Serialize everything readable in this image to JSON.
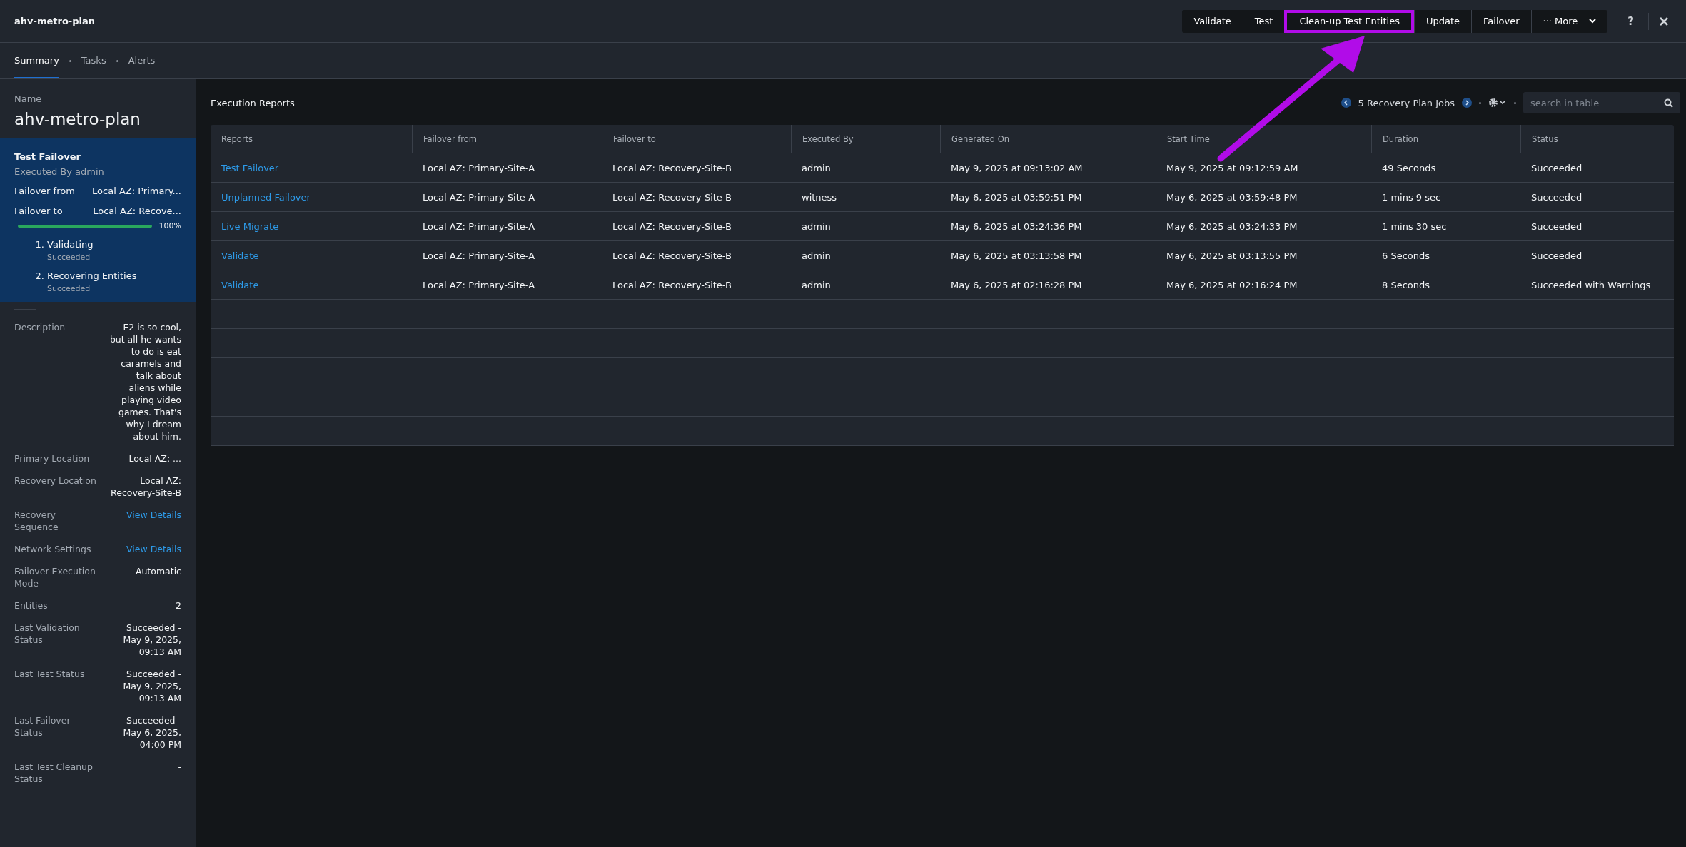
{
  "header": {
    "title": "ahv-metro-plan",
    "actions": [
      {
        "label": "Validate",
        "highlighted": false
      },
      {
        "label": "Test",
        "highlighted": false
      },
      {
        "label": "Clean-up Test Entities",
        "highlighted": true
      },
      {
        "label": "Update",
        "highlighted": false
      },
      {
        "label": "Failover",
        "highlighted": false
      },
      {
        "label": "··· More",
        "highlighted": false
      }
    ],
    "help": "?"
  },
  "tabs": [
    {
      "label": "Summary",
      "selected": true
    },
    {
      "label": "Tasks",
      "selected": false
    },
    {
      "label": "Alerts",
      "selected": false
    }
  ],
  "summary": {
    "name_label": "Name",
    "name": "ahv-metro-plan",
    "last_run": {
      "title": "Test Failover",
      "executed_by": "Executed By admin",
      "fields": [
        {
          "label": "Failover from",
          "value": "Local AZ: Primary..."
        },
        {
          "label": "Failover to",
          "value": "Local AZ: Recove..."
        }
      ],
      "progress": {
        "level": 1.0,
        "reading": "100%"
      },
      "steps": [
        {
          "number": "1.",
          "name": "Validating",
          "status": "Succeeded"
        },
        {
          "number": "2.",
          "name": "Recovering Entities",
          "status": "Succeeded"
        }
      ]
    },
    "details": [
      {
        "label": "Description",
        "value": "E2 is so cool, but all he wants to do is eat caramels and talk about aliens while playing video games. That's why I dream about him.",
        "kind": "text"
      },
      {
        "label": "Primary Location",
        "value": "Local AZ: ...",
        "kind": "text"
      },
      {
        "label": "Recovery Location",
        "value": "Local AZ: Recovery-Site-B",
        "kind": "text"
      },
      {
        "label": "Recovery Sequence",
        "value": "View Details",
        "kind": "link"
      },
      {
        "label": "Network Settings",
        "value": "View Details",
        "kind": "link"
      },
      {
        "label": "Failover Execution Mode",
        "value": "Automatic",
        "kind": "text"
      },
      {
        "label": "Entities",
        "value": "2",
        "kind": "text"
      },
      {
        "label": "Last Validation Status",
        "value": "Succeeded - May 9, 2025, 09:13 AM",
        "kind": "text"
      },
      {
        "label": "Last Test Status",
        "value": "Succeeded - May 9, 2025, 09:13 AM",
        "kind": "text"
      },
      {
        "label": "Last Failover Status",
        "value": "Succeeded - May 6, 2025, 04:00 PM",
        "kind": "text"
      },
      {
        "label": "Last Test Cleanup Status",
        "value": "-",
        "kind": "text"
      }
    ]
  },
  "reports": {
    "title": "Execution Reports",
    "count": "5 Recovery Plan Jobs",
    "search": {
      "placeholder": "search in table"
    },
    "table": {
      "columns": [
        "Reports",
        "Failover from",
        "Failover to",
        "Executed By",
        "Generated On",
        "Start Time",
        "Duration",
        "Status"
      ],
      "rows": [
        [
          "Test Failover",
          "Local AZ: Primary-Site-A",
          "Local AZ: Recovery-Site-B",
          "admin",
          "May 9, 2025 at 09:13:02 AM",
          "May 9, 2025 at 09:12:59 AM",
          "49 Seconds",
          "Succeeded"
        ],
        [
          "Unplanned Failover",
          "Local AZ: Primary-Site-A",
          "Local AZ: Recovery-Site-B",
          "witness",
          "May 6, 2025 at 03:59:51 PM",
          "May 6, 2025 at 03:59:48 PM",
          "1 mins 9 sec",
          "Succeeded"
        ],
        [
          "Live Migrate",
          "Local AZ: Primary-Site-A",
          "Local AZ: Recovery-Site-B",
          "admin",
          "May 6, 2025 at 03:24:36 PM",
          "May 6, 2025 at 03:24:33 PM",
          "1 mins 30 sec",
          "Succeeded"
        ],
        [
          "Validate",
          "Local AZ: Primary-Site-A",
          "Local AZ: Recovery-Site-B",
          "admin",
          "May 6, 2025 at 03:13:58 PM",
          "May 6, 2025 at 03:13:55 PM",
          "6 Seconds",
          "Succeeded"
        ],
        [
          "Validate",
          "Local AZ: Primary-Site-A",
          "Local AZ: Recovery-Site-B",
          "admin",
          "May 6, 2025 at 02:16:28 PM",
          "May 6, 2025 at 02:16:24 PM",
          "8 Seconds",
          "Succeeded with Warnings"
        ]
      ]
    }
  }
}
